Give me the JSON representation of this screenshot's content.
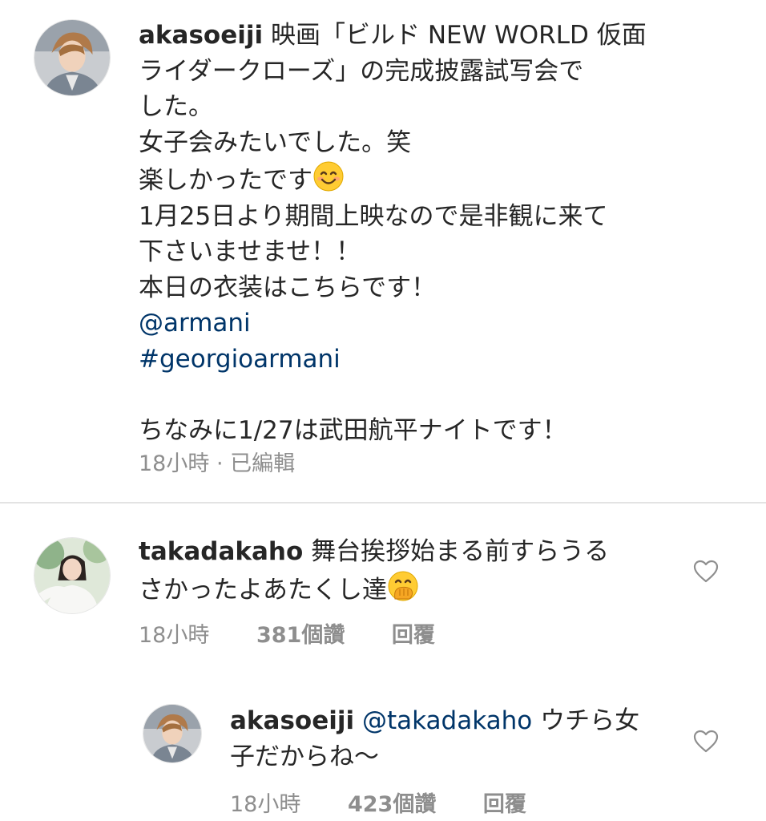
{
  "caption": {
    "username": "akasoeiji",
    "lines": [
      "映画「ビルド NEW WORLD 仮面",
      "ライダークローズ」の完成披露試写会で",
      "した。",
      "女子会みたいでした。笑",
      "楽しかったです",
      "1月25日より期間上映なので是非観に来て",
      "下さいませませ！！",
      "本日の衣装はこちらです！"
    ],
    "mention": "@armani",
    "hashtag": "#georgioarmani",
    "footer_line": "ちなみに1/27は武田航平ナイトです！",
    "time": "18小時",
    "separator": "·",
    "edited": "已編輯"
  },
  "comments": [
    {
      "username": "takadakaho",
      "lines": [
        "舞台挨拶始まる前すらうる",
        "さかったよあたくし達"
      ],
      "time": "18小時",
      "likes": "381個讚",
      "reply": "回覆"
    },
    {
      "username": "akasoeiji",
      "mention": "@takadakaho",
      "lines": [
        "ウチら女",
        "子だからね〜"
      ],
      "time": "18小時",
      "likes": "423個讚",
      "reply": "回覆"
    }
  ],
  "icons": {
    "smile": "smiling-face-emoji",
    "hand_over_mouth": "face-with-hand-over-mouth-emoji",
    "like": "heart-outline-icon"
  },
  "colors": {
    "text": "#262626",
    "link": "#003569",
    "meta": "#8e8e8e",
    "divider": "#e3e3e3"
  }
}
